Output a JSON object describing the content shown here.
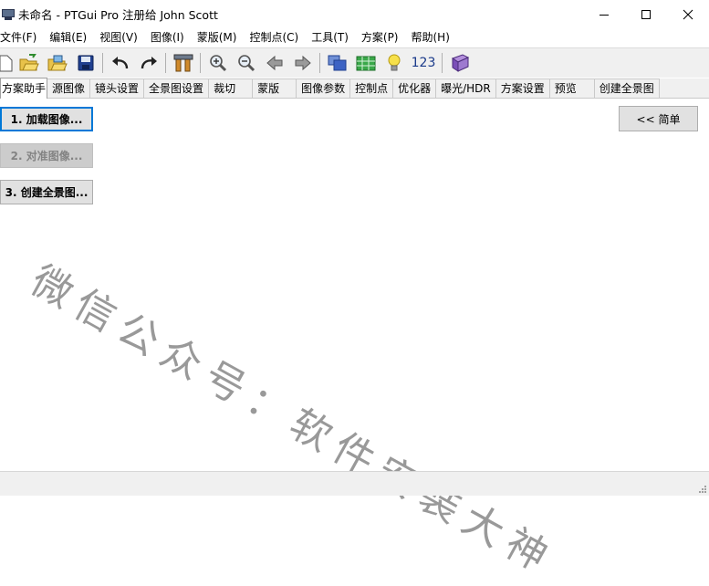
{
  "window": {
    "title": "未命名 - PTGui Pro 注册给 John Scott"
  },
  "menu": [
    "文件(F)",
    "编辑(E)",
    "视图(V)",
    "图像(I)",
    "蒙版(M)",
    "控制点(C)",
    "工具(T)",
    "方案(P)",
    "帮助(H)"
  ],
  "toolbar": {
    "icons": [
      "new-project-icon",
      "open-project-icon",
      "open-images-icon",
      "save-icon",
      "undo-icon",
      "redo-icon",
      "tools-icon",
      "zoom-in-icon",
      "zoom-out-icon",
      "arrow-left-icon",
      "arrow-right-icon",
      "panorama-editor-icon",
      "table-icon",
      "tip-bulb-icon",
      "numbers-icon",
      "help-book-icon"
    ],
    "numbers_label": "123"
  },
  "tabs": [
    "方案助手",
    "源图像",
    "镜头设置",
    "全景图设置",
    "裁切",
    "蒙版",
    "图像参数",
    "控制点",
    "优化器",
    "曝光/HDR",
    "方案设置",
    "预览",
    "创建全景图"
  ],
  "wizard": {
    "load_images": "1. 加载图像...",
    "align_images": "2. 对准图像...",
    "create_panorama": "3. 创建全景图..."
  },
  "simple_button": "<< 简单",
  "watermark": "微信公众号：软件安装大神"
}
